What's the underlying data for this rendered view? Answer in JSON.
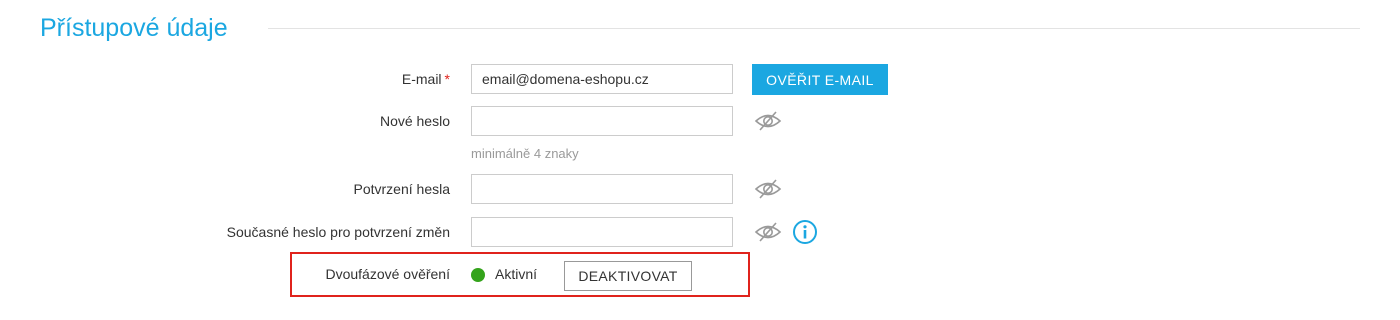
{
  "section": {
    "title": "Přístupové údaje"
  },
  "email": {
    "label": "E-mail",
    "required_marker": "*",
    "value": "email@domena-eshopu.cz",
    "verify_button": "OVĚŘIT E-MAIL"
  },
  "new_password": {
    "label": "Nové heslo",
    "value": "",
    "hint": "minimálně 4 znaky",
    "toggle_icon": "eye-slash-icon"
  },
  "confirm_password": {
    "label": "Potvrzení hesla",
    "value": "",
    "toggle_icon": "eye-slash-icon"
  },
  "current_password": {
    "label": "Současné heslo pro potvrzení změn",
    "value": "",
    "toggle_icon": "eye-slash-icon",
    "info_icon": "info-icon"
  },
  "two_factor": {
    "label": "Dvoufázové ověření",
    "status": "Aktivní",
    "status_color": "#34a31b",
    "deactivate_button": "DEAKTIVOVAT"
  },
  "colors": {
    "accent": "#1ba7e1",
    "required": "#e0231c",
    "highlight_border": "#e0231c"
  }
}
